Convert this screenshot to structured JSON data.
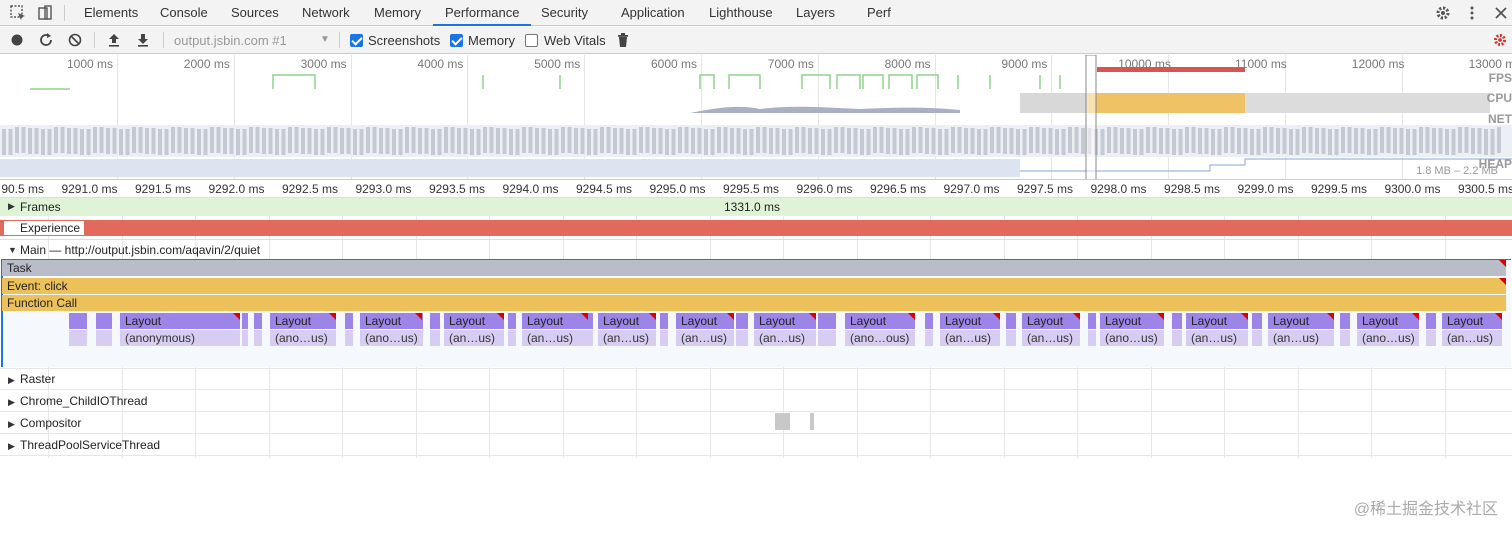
{
  "tabs": [
    "Elements",
    "Console",
    "Sources",
    "Network",
    "Memory",
    "Performance",
    "Security",
    "Application",
    "Lighthouse",
    "Layers",
    "Perf"
  ],
  "active_tab": "Performance",
  "toolbar": {
    "recording_select": "output.jsbin.com #1",
    "screenshots_label": "Screenshots",
    "screenshots_checked": true,
    "memory_label": "Memory",
    "memory_checked": true,
    "webvitals_label": "Web Vitals",
    "webvitals_checked": false
  },
  "overview": {
    "ticks": [
      "1000 ms",
      "2000 ms",
      "3000 ms",
      "4000 ms",
      "5000 ms",
      "6000 ms",
      "7000 ms",
      "8000 ms",
      "9000 ms",
      "10000 ms",
      "11000 ms",
      "12000 ms",
      "13000 ms"
    ],
    "labels": {
      "fps": "FPS",
      "cpu": "CPU",
      "net": "NET",
      "heap": "HEAP",
      "heap_range": "1.8 MB – 2.2 MB"
    }
  },
  "ruler": [
    "90.5 ms",
    "9291.0 ms",
    "9291.5 ms",
    "9292.0 ms",
    "9292.5 ms",
    "9293.0 ms",
    "9293.5 ms",
    "9294.0 ms",
    "9294.5 ms",
    "9295.0 ms",
    "9295.5 ms",
    "9296.0 ms",
    "9296.5 ms",
    "9297.0 ms",
    "9297.5 ms",
    "9298.0 ms",
    "9298.5 ms",
    "9299.0 ms",
    "9299.5 ms",
    "9300.0 ms",
    "9300.5 ms"
  ],
  "tracks": {
    "frames": "Frames",
    "frames_duration": "1331.0 ms",
    "experience": "Experience",
    "main": "Main — http://output.jsbin.com/aqavin/2/quiet",
    "task": "Task",
    "event": "Event: click",
    "function_call": "Function Call",
    "raster": "Raster",
    "child_io": "Chrome_ChildIOThread",
    "compositor": "Compositor",
    "threadpool": "ThreadPoolServiceThread"
  },
  "layout_label": "Layout",
  "anon_labels": [
    "(anonymous)",
    "(ano…us)",
    "(ano…us)",
    "(an…us)",
    "(an…us)",
    "(an…us)",
    "(an…us)",
    "(an…us)",
    "(ano…ous)",
    "(an…us)",
    "(an…us)",
    "(ano…us)",
    "(an…us)",
    "(an…us)",
    "(ano…us)",
    "(an…us)"
  ],
  "watermark": "@稀土掘金技术社区",
  "colors": {
    "task": "#b8bdc9",
    "event": "#ecc15a",
    "experience": "#e26a5c",
    "layout": "#9c84e8",
    "frames": "#d9f2d0",
    "active_tab": "#1a73e8"
  }
}
